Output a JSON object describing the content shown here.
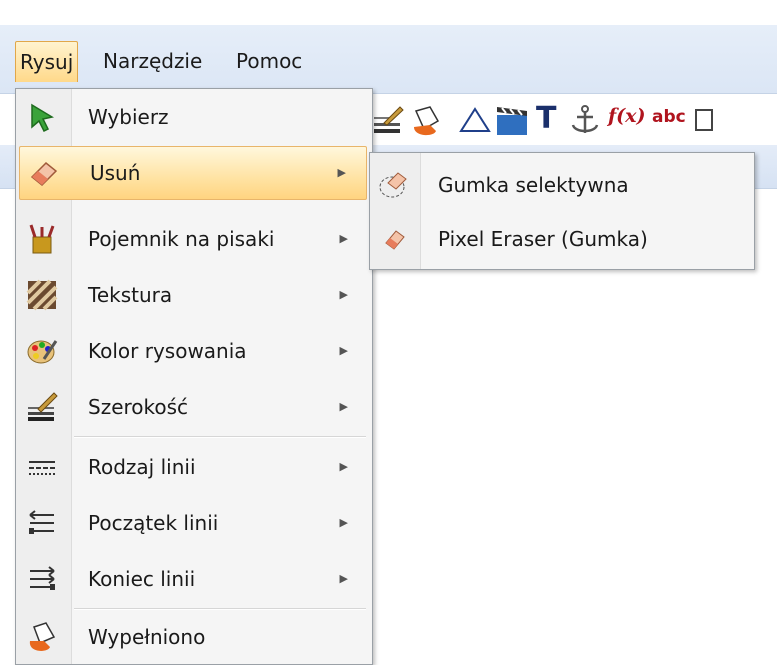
{
  "menubar": {
    "items": [
      {
        "label": "Rysuj",
        "active": true
      },
      {
        "label": "Narzędzie",
        "active": false
      },
      {
        "label": "Pomoc",
        "active": false
      }
    ]
  },
  "toolbar": {
    "text_tool_label": "T",
    "fx_label": "f(x)",
    "abc_label": "abc"
  },
  "draw_menu": {
    "items": [
      {
        "label": "Wybierz",
        "icon": "select-arrow-icon",
        "has_submenu": false
      },
      {
        "label": "Usuń",
        "icon": "eraser-icon",
        "has_submenu": true,
        "highlighted": true
      },
      {
        "label": "Pojemnik na pisaki",
        "icon": "pen-holder-icon",
        "has_submenu": true
      },
      {
        "label": "Tekstura",
        "icon": "texture-icon",
        "has_submenu": true
      },
      {
        "label": "Kolor rysowania",
        "icon": "palette-icon",
        "has_submenu": true
      },
      {
        "label": "Szerokość",
        "icon": "line-width-icon",
        "has_submenu": true
      },
      {
        "label": "Rodzaj linii",
        "icon": "line-type-icon",
        "has_submenu": true
      },
      {
        "label": "Początek linii",
        "icon": "line-start-icon",
        "has_submenu": true
      },
      {
        "label": "Koniec linii",
        "icon": "line-end-icon",
        "has_submenu": true
      },
      {
        "label": "Wypełniono",
        "icon": "fill-icon",
        "has_submenu": false
      }
    ]
  },
  "erase_submenu": {
    "items": [
      {
        "label": "Gumka selektywna",
        "icon": "selective-eraser-icon"
      },
      {
        "label": "Pixel Eraser (Gumka)",
        "icon": "pixel-eraser-icon"
      }
    ]
  },
  "colors": {
    "highlight": "#ffe3a3",
    "highlight_border": "#e8b56a",
    "menubar_bg": "#dbe6f5",
    "menu_bg": "#f5f5f5"
  }
}
